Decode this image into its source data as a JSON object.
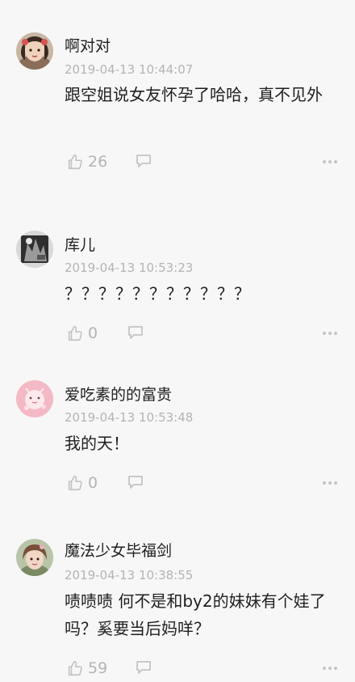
{
  "comments": [
    {
      "username": "啊对对",
      "time": "2019-04-13 10:44:07",
      "text": "跟空姐说女友怀孕了哈哈，真不见外",
      "likes": "26"
    },
    {
      "username": "库儿",
      "time": "2019-04-13 10:53:23",
      "text": "？？？？？？？？？？？",
      "likes": "0"
    },
    {
      "username": "爱吃素的的富贵",
      "time": "2019-04-13 10:53:48",
      "text": "我的天！",
      "likes": "0"
    },
    {
      "username": "魔法少女毕福剑",
      "time": "2019-04-13 10:38:55",
      "text": "啧啧啧 何不是和by2的妹妹有个娃了吗？奚要当后妈咩？",
      "likes": "59"
    }
  ],
  "icons": {
    "like": "thumbs-up-icon",
    "reply": "speech-bubble-icon",
    "more": "more-dots-icon"
  },
  "colors": {
    "background": "#f7f7f7",
    "text": "#1f1f1f",
    "muted": "#b4b4b4"
  }
}
